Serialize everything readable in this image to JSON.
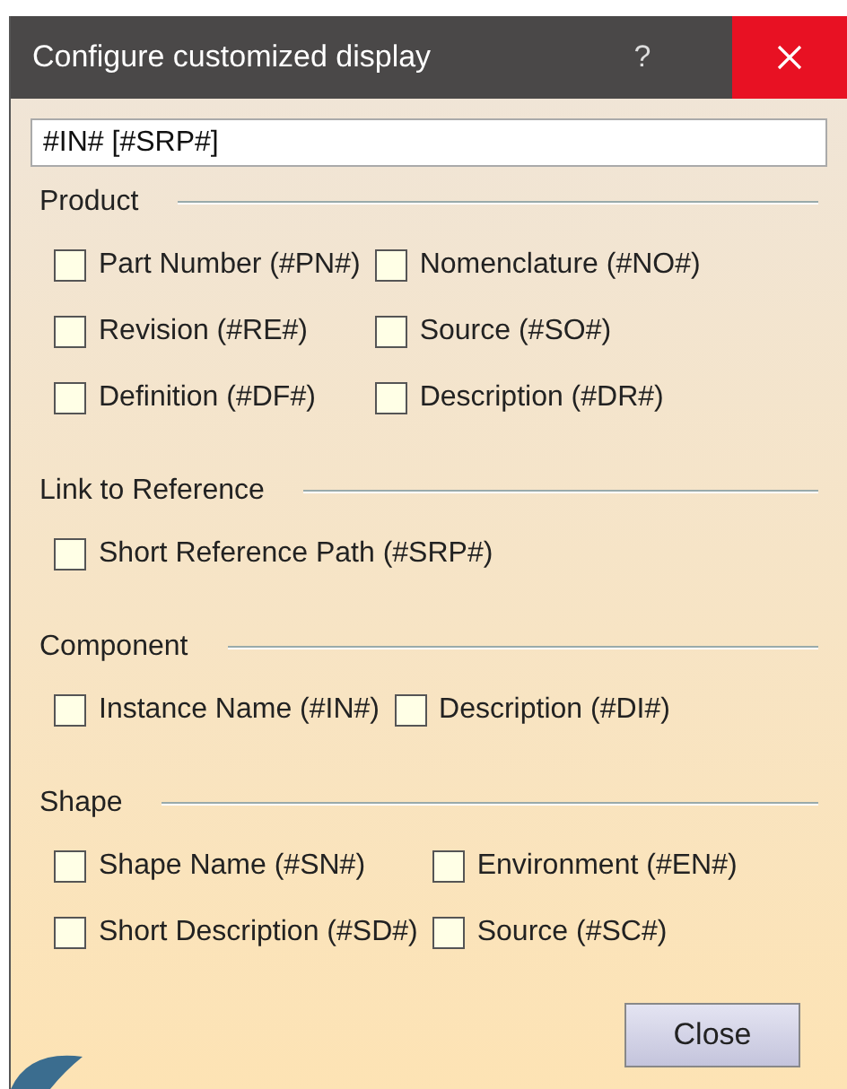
{
  "window": {
    "title": "Configure customized display",
    "help": "?"
  },
  "format_field": {
    "value": "#IN# [#SRP#]"
  },
  "sections": [
    {
      "title": "Product",
      "options": [
        {
          "label": "Part Number (#PN#)",
          "checked": false
        },
        {
          "label": "Nomenclature (#NO#)",
          "checked": false
        },
        {
          "label": "Revision (#RE#)",
          "checked": false
        },
        {
          "label": "Source (#SO#)",
          "checked": false
        },
        {
          "label": "Definition (#DF#)",
          "checked": false
        },
        {
          "label": "Description (#DR#)",
          "checked": false
        }
      ]
    },
    {
      "title": "Link to Reference",
      "options": [
        {
          "label": "Short Reference Path (#SRP#)",
          "checked": false
        }
      ]
    },
    {
      "title": "Component",
      "options": [
        {
          "label": "Instance Name (#IN#)",
          "checked": false
        },
        {
          "label": "Description (#DI#)",
          "checked": false
        }
      ]
    },
    {
      "title": "Shape",
      "options": [
        {
          "label": "Shape Name (#SN#)",
          "checked": false
        },
        {
          "label": "Environment (#EN#)",
          "checked": false
        },
        {
          "label": "Short Description (#SD#)",
          "checked": false
        },
        {
          "label": "Source (#SC#)",
          "checked": false
        }
      ]
    }
  ],
  "buttons": [
    "Close"
  ]
}
